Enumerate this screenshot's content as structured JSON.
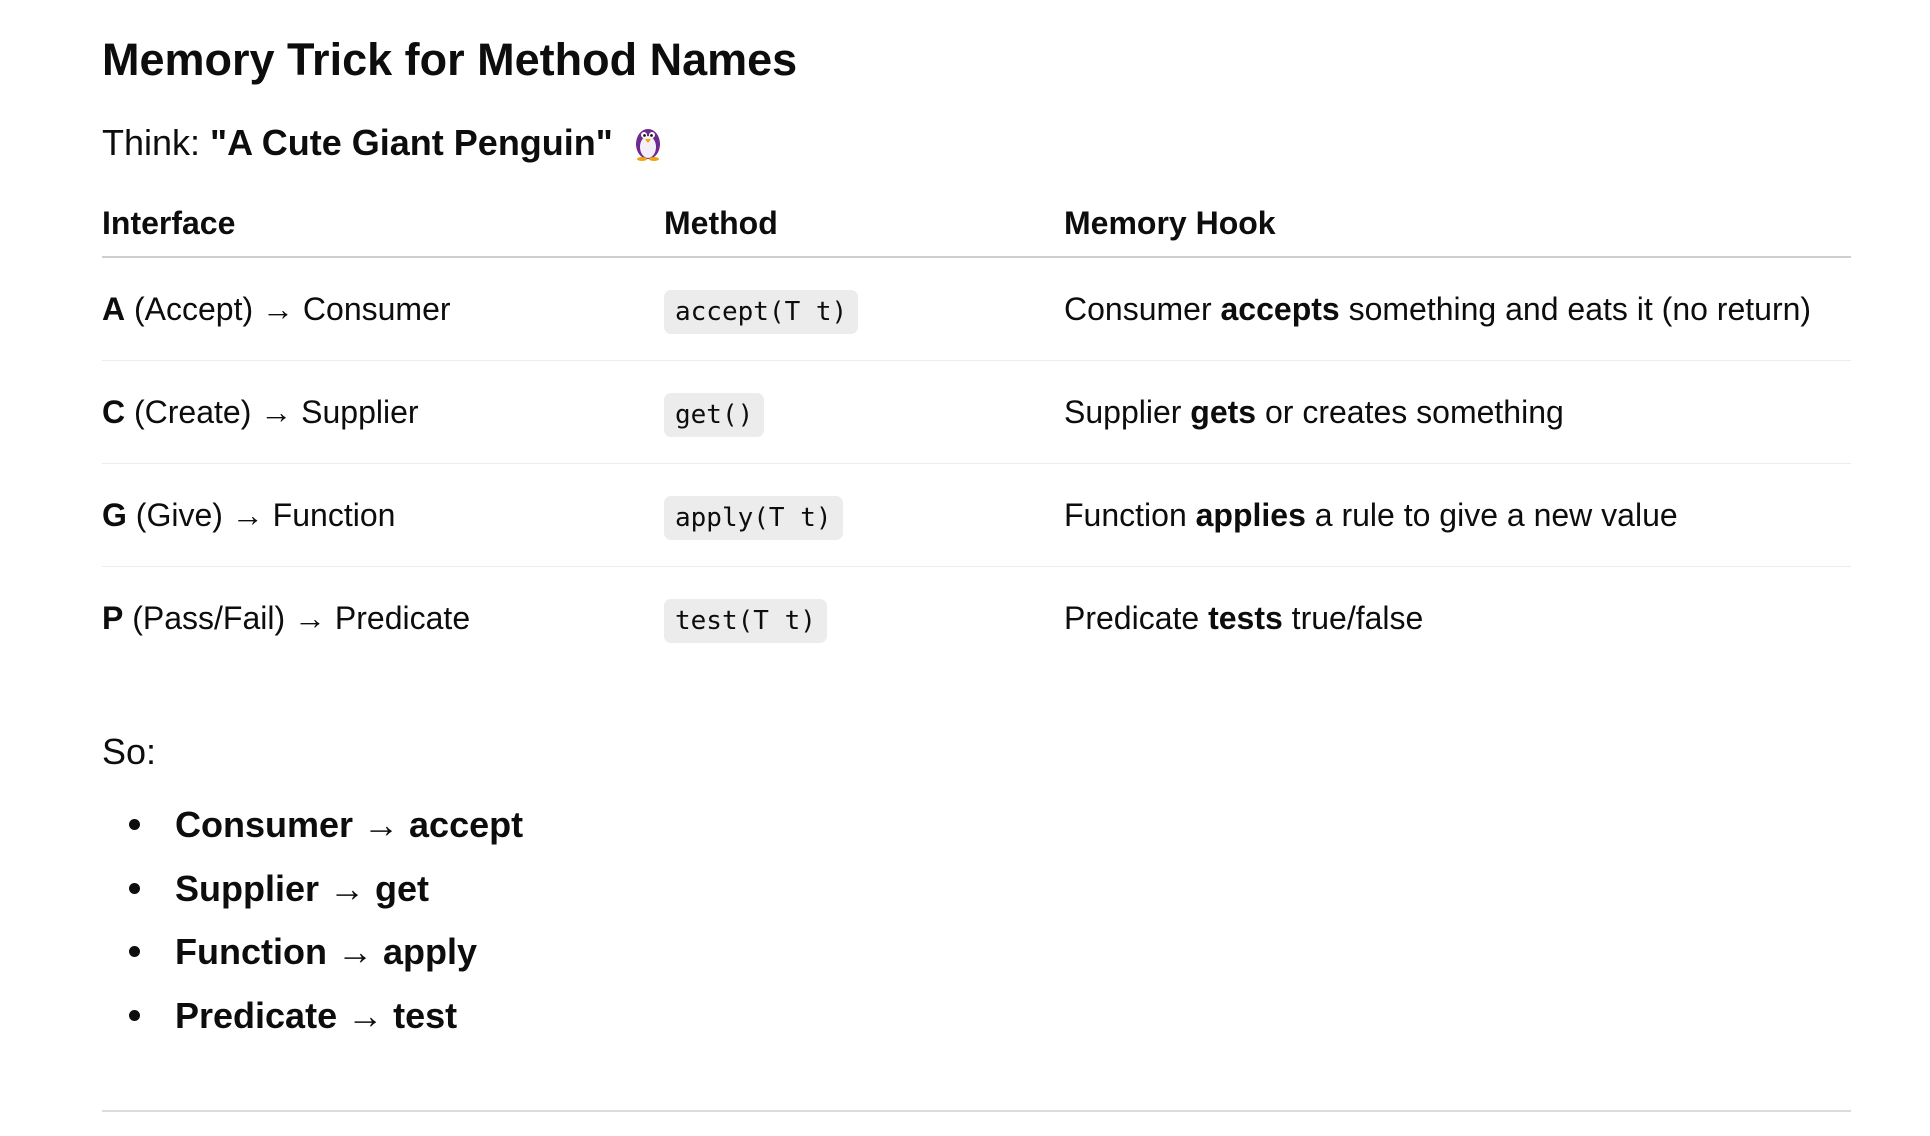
{
  "heading": "Memory Trick for Method Names",
  "think": {
    "prefix": "Think: ",
    "phrase": "\"A Cute Giant Penguin\"",
    "icon": "penguin-emoji"
  },
  "table": {
    "headers": [
      "Interface",
      "Method",
      "Memory Hook"
    ],
    "rows": [
      {
        "letter": "A",
        "hint": " (Accept) → Consumer",
        "method": "accept(T t)",
        "hook_before": "Consumer ",
        "hook_bold": "accepts",
        "hook_after": " something and eats it (no return)"
      },
      {
        "letter": "C",
        "hint": " (Create) → Supplier",
        "method": "get()",
        "hook_before": "Supplier ",
        "hook_bold": "gets",
        "hook_after": " or creates something"
      },
      {
        "letter": "G",
        "hint": " (Give) → Function",
        "method": "apply(T t)",
        "hook_before": "Function ",
        "hook_bold": "applies",
        "hook_after": " a rule to give a new value"
      },
      {
        "letter": "P",
        "hint": " (Pass/Fail) → Predicate",
        "method": "test(T t)",
        "hook_before": "Predicate ",
        "hook_bold": "tests",
        "hook_after": " true/false"
      }
    ]
  },
  "so_label": "So:",
  "summary": [
    "Consumer → accept",
    "Supplier → get",
    "Function → apply",
    "Predicate → test"
  ]
}
